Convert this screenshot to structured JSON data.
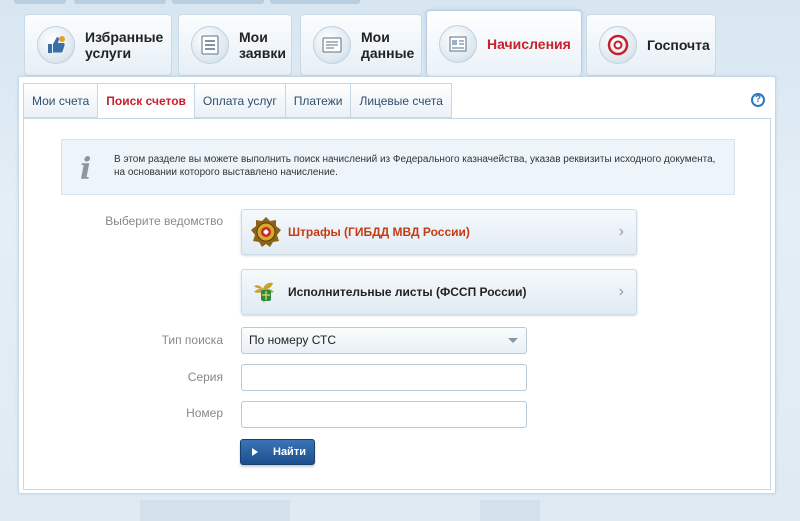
{
  "main_tabs": [
    {
      "label": "Избранные\nуслуги",
      "icon": "thumbs-up-icon",
      "active": false
    },
    {
      "label": "Мои\nзаявки",
      "icon": "checklist-icon",
      "active": false
    },
    {
      "label": "Мои\nданные",
      "icon": "id-card-icon",
      "active": false
    },
    {
      "label": "Начисления",
      "icon": "invoice-icon",
      "active": true
    },
    {
      "label": "Госпочта",
      "icon": "at-mail-icon",
      "active": false
    }
  ],
  "sub_tabs": [
    {
      "label": "Мои счета",
      "active": false
    },
    {
      "label": "Поиск счетов",
      "active": true
    },
    {
      "label": "Оплата услуг",
      "active": false
    },
    {
      "label": "Платежи",
      "active": false
    },
    {
      "label": "Лицевые счета",
      "active": false
    }
  ],
  "help": {
    "glyph": "?"
  },
  "info": {
    "icon_glyph": "i",
    "text": "В этом разделе вы можете выполнить поиск начислений из Федерального казначейства, указав реквизиты исходного документа, на основании которого выставлено начисление."
  },
  "form": {
    "agency_label": "Выберите ведомство",
    "agencies": [
      {
        "label": "Штрафы (ГИБДД МВД России)",
        "highlight": true
      },
      {
        "label": "Исполнительные листы (ФССП России)",
        "highlight": false
      }
    ],
    "chevron": "›",
    "search_type_label": "Тип поиска",
    "search_type_value": "По номеру СТС",
    "series_label": "Серия",
    "series_value": "",
    "number_label": "Номер",
    "number_value": "",
    "submit_label": "Найти"
  },
  "colors": {
    "accent_red": "#c8202b",
    "link_blue": "#2f4e6e",
    "button_blue": "#1b4f8e"
  }
}
